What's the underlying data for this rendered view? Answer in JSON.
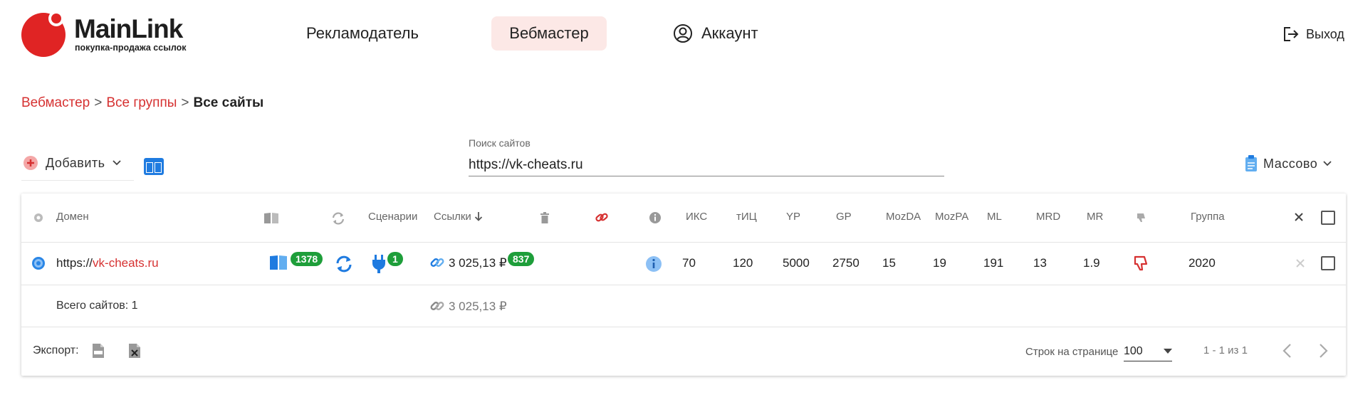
{
  "brand": {
    "name": "MainLink",
    "tagline": "покупка-продажа ссылок"
  },
  "nav": {
    "advertiser": "Рекламодатель",
    "webmaster": "Вебмастер",
    "account": "Аккаунт",
    "logout": "Выход"
  },
  "breadcrumb": {
    "item1": "Вебмастер",
    "item2": "Все группы",
    "current": "Все сайты",
    "separator": ">"
  },
  "toolbar": {
    "add_label": "Добавить",
    "mass_label": "Массово"
  },
  "search": {
    "label": "Поиск сайтов",
    "value": "https://vk-cheats.ru"
  },
  "table": {
    "headers": {
      "domain": "Домен",
      "scenarios": "Сценарии",
      "links": "Ссылки",
      "iks": "ИКС",
      "tic": "тИЦ",
      "yr": "YP",
      "gp": "GP",
      "mozda": "MozDA",
      "mozpa": "MozPA",
      "ml": "ML",
      "mrd": "MRD",
      "mr": "MR",
      "group": "Группа"
    },
    "row": {
      "domain_prefix": "https://",
      "domain_name": "vk-cheats.ru",
      "pages_badge": "1378",
      "scenarios_badge": "1",
      "links_amount": "3 025,13 ₽",
      "links_badge": "837",
      "iks": "70",
      "tic": "120",
      "yr": "5000",
      "gp": "2750",
      "mozda": "15",
      "mozpa": "19",
      "ml": "191",
      "mrd": "13",
      "mr": "1.9",
      "group": "2020"
    },
    "totals": {
      "sites_label": "Всего сайтов: 1",
      "amount": "3 025,13 ₽"
    }
  },
  "footer": {
    "export_label": "Экспорт:",
    "rows_label": "Строк на странице",
    "rows_value": "100",
    "range": "1 - 1 из 1"
  },
  "colors": {
    "accent": "#d63131",
    "nav_active_bg": "#fce8e6",
    "link_blue": "#1f80e0",
    "badge_green": "#1e9e3a"
  },
  "icons": [
    "gear-icon",
    "book-icon",
    "sync-icon",
    "plug-icon",
    "link-icon",
    "trash-icon",
    "broken-link-icon",
    "info-icon",
    "thumbs-down-icon",
    "close-icon",
    "csv-file-icon",
    "xls-file-icon",
    "logout-icon",
    "user-icon",
    "plus-icon",
    "columns-icon",
    "clipboard-icon",
    "chevron-left-icon",
    "chevron-right-icon"
  ]
}
